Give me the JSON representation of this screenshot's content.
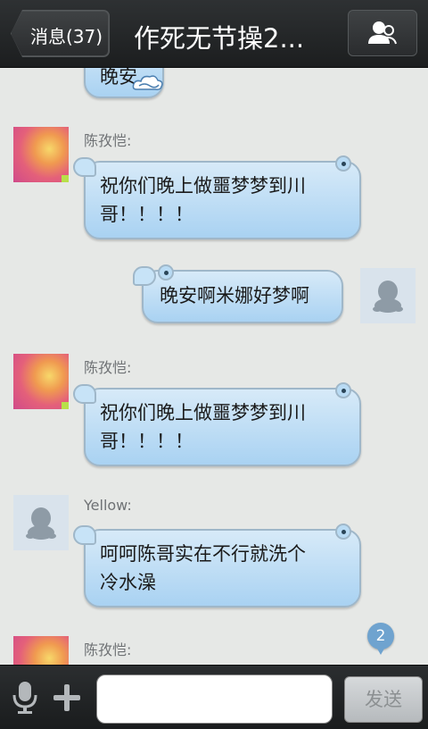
{
  "header": {
    "back_label": "消息(37)",
    "title": "作死无节操2...",
    "members_icon": "group-members-icon"
  },
  "messages": [
    {
      "id": "m0",
      "side": "left",
      "sender": "",
      "text": "晚安",
      "partial": true,
      "sticker": "cloud-icon"
    },
    {
      "id": "m1",
      "side": "left",
      "sender": "陈孜恺:",
      "text_lines": [
        "祝你们晚上做噩梦梦到川",
        "哥！！！！"
      ],
      "avatar": "photo"
    },
    {
      "id": "m2",
      "side": "right",
      "sender": "",
      "text_lines": [
        "晚安啊米娜好梦啊"
      ],
      "avatar": "qq-default"
    },
    {
      "id": "m3",
      "side": "left",
      "sender": "陈孜恺:",
      "text_lines": [
        "祝你们晚上做噩梦梦到川",
        "哥！！！！"
      ],
      "avatar": "photo"
    },
    {
      "id": "m4",
      "side": "left",
      "sender": "Yellow:",
      "text_lines": [
        "呵呵陈哥实在不行就洗个",
        "冷水澡"
      ],
      "avatar": "qq-default"
    },
    {
      "id": "m5",
      "side": "left",
      "sender": "陈孜恺:",
      "text_lines": [],
      "avatar": "photo",
      "partial": true
    }
  ],
  "unread_badge": "2",
  "bottom": {
    "voice_icon": "microphone-icon",
    "plus_icon": "plus-icon",
    "input_placeholder": "",
    "input_value": "",
    "send_label": "发送"
  },
  "colors": {
    "header_bg": "#25282a",
    "chat_bg": "#e6e8e6",
    "bubble": "#b9dcf5",
    "badge": "#6fa3cf"
  }
}
